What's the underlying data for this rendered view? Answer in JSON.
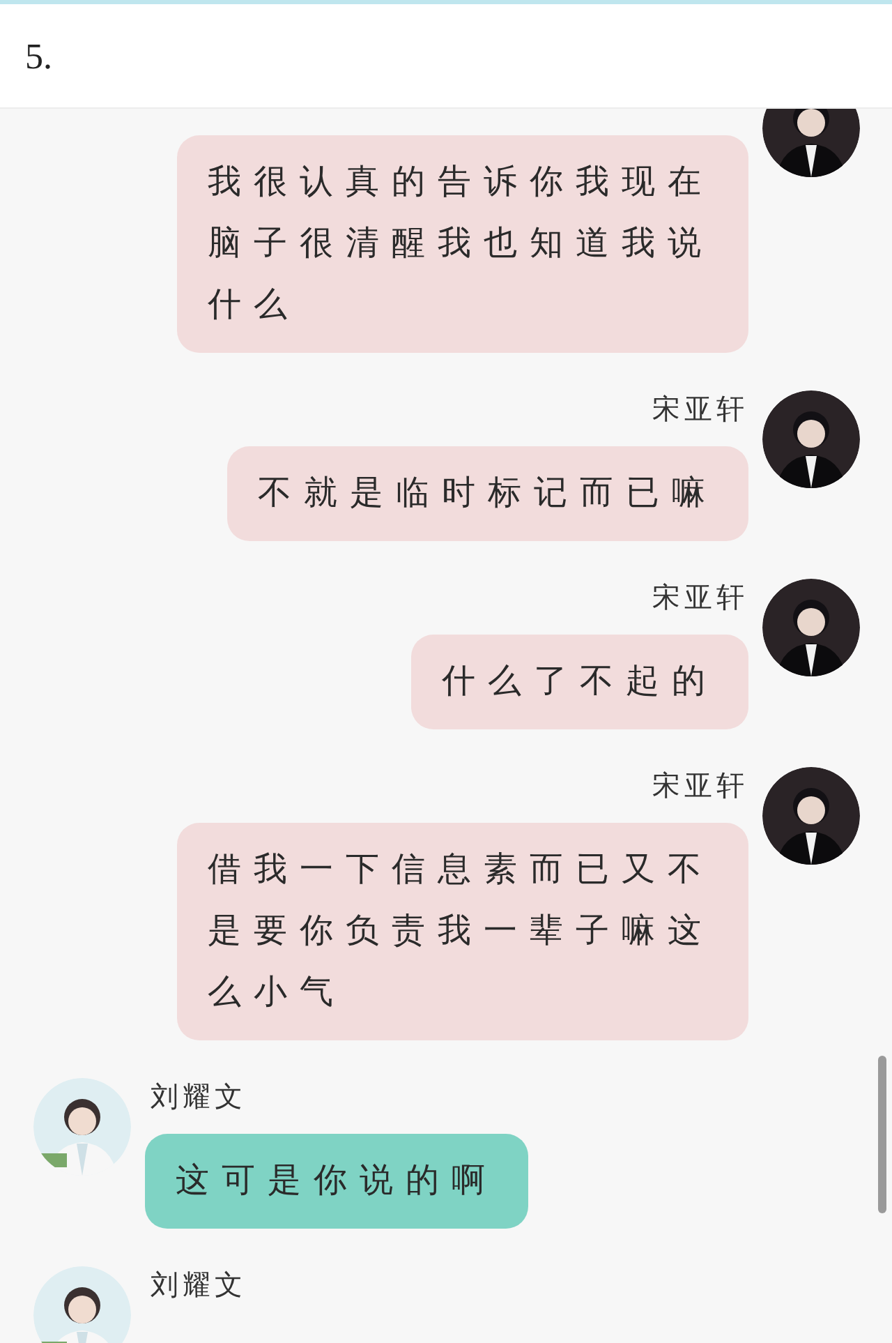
{
  "header": {
    "title": "5."
  },
  "messages": [
    {
      "kind": "outgoing",
      "text": "我很认真的告诉你我现在脑子很清醒我也知道我说什么"
    },
    {
      "kind": "outgoing",
      "name": "宋亚轩",
      "text": "不就是临时标记而已嘛"
    },
    {
      "kind": "outgoing",
      "name": "宋亚轩",
      "text": "什么了不起的"
    },
    {
      "kind": "outgoing",
      "name": "宋亚轩",
      "text": "借我一下信息素而已又不是要你负责我一辈子嘛这么小气"
    },
    {
      "kind": "incoming",
      "name": "刘耀文",
      "text": "这可是你说的啊"
    },
    {
      "kind": "incoming",
      "name": "刘耀文"
    }
  ]
}
